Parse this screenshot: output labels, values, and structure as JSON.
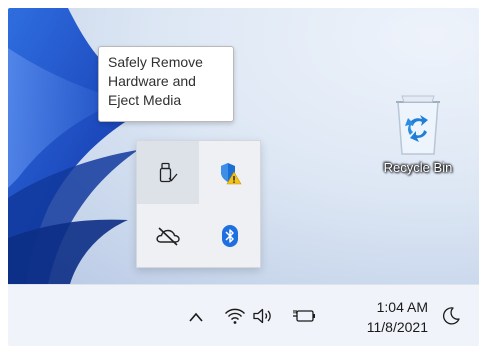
{
  "tooltip": {
    "lines": [
      "Safely Remove",
      "Hardware and",
      "Eject Media"
    ]
  },
  "desktop": {
    "recycle_bin_label": "Recycle Bin"
  },
  "tray_overflow": {
    "icons": [
      "usb-drive-icon",
      "windows-security-warning-icon",
      "onedrive-icon",
      "bluetooth-icon"
    ]
  },
  "taskbar": {
    "icons": [
      "chevron-up-icon",
      "wifi-icon",
      "speaker-icon",
      "battery-icon",
      "moon-icon"
    ],
    "time": "1:04 AM",
    "date": "11/8/2021"
  },
  "colors": {
    "desktop_bg": "#dde7f4",
    "bloom_blue": "#1d52c8",
    "taskbar_bg": "#f0f3f9",
    "shield_blue": "#1a6fd1",
    "warning_yellow": "#f2c21b",
    "bluetooth_blue": "#1f6fe0"
  }
}
